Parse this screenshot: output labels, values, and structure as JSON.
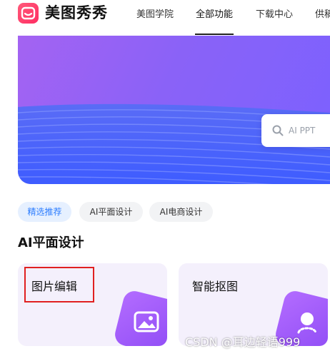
{
  "header": {
    "brand": "美图秀秀",
    "nav": [
      "美图学院",
      "全部功能",
      "下载中心",
      "供稿"
    ],
    "active_nav": "全部功能"
  },
  "banner": {
    "search_placeholder": "AI PPT",
    "search_icon": "search-icon"
  },
  "chips": {
    "items": [
      "精选推荐",
      "AI平面设计",
      "AI电商设计"
    ],
    "active": "精选推荐"
  },
  "section": {
    "title": "AI平面设计"
  },
  "cards": [
    {
      "title": "图片编辑",
      "icon": "image-icon"
    },
    {
      "title": "智能抠图",
      "icon": "cutout-icon"
    }
  ],
  "watermark": "CSDN @耳边轻语999",
  "colors": {
    "brand": "#ff2d62",
    "banner": "#8a62f7",
    "chip_active": "#2b7cff",
    "card_icon": "#9b55f5",
    "highlight": "#e02020"
  }
}
